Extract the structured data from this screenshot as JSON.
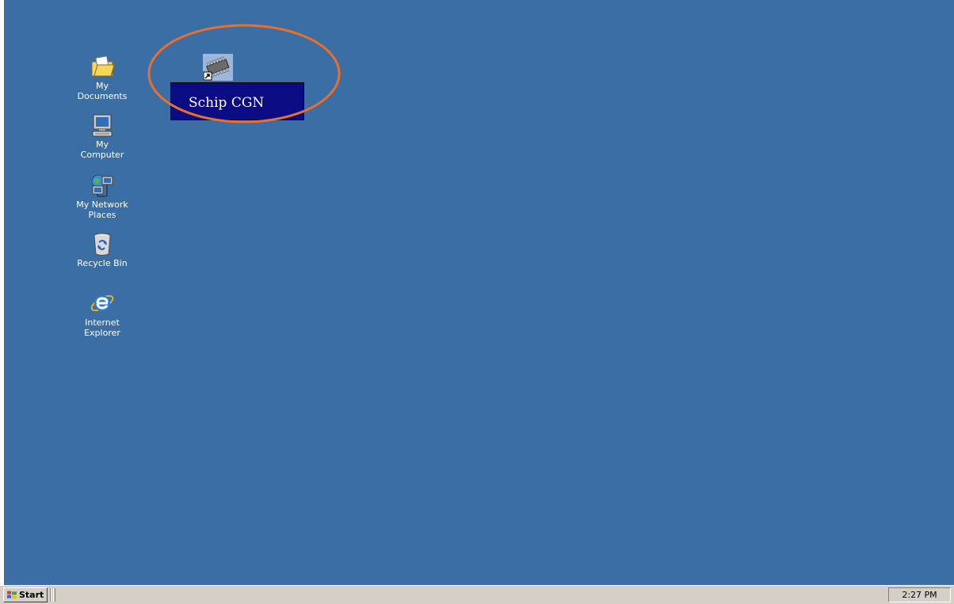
{
  "desktop": {
    "background_color": "#3a6ea5",
    "icons": [
      {
        "label": "My Documents",
        "icon": "folder-documents-icon"
      },
      {
        "label": "My Computer",
        "icon": "computer-icon"
      },
      {
        "label": "My Network\nPlaces",
        "icon": "network-icon"
      },
      {
        "label": "Recycle Bin",
        "icon": "recycle-bin-icon"
      },
      {
        "label": "Internet\nExplorer",
        "icon": "internet-explorer-icon"
      }
    ],
    "shortcut": {
      "label": "Schip CGN",
      "icon": "chip-shortcut-icon",
      "label_background": "#0b0b84",
      "highlight_color": "#e8702a"
    }
  },
  "taskbar": {
    "start_label": "Start",
    "clock": "2:27 PM"
  }
}
